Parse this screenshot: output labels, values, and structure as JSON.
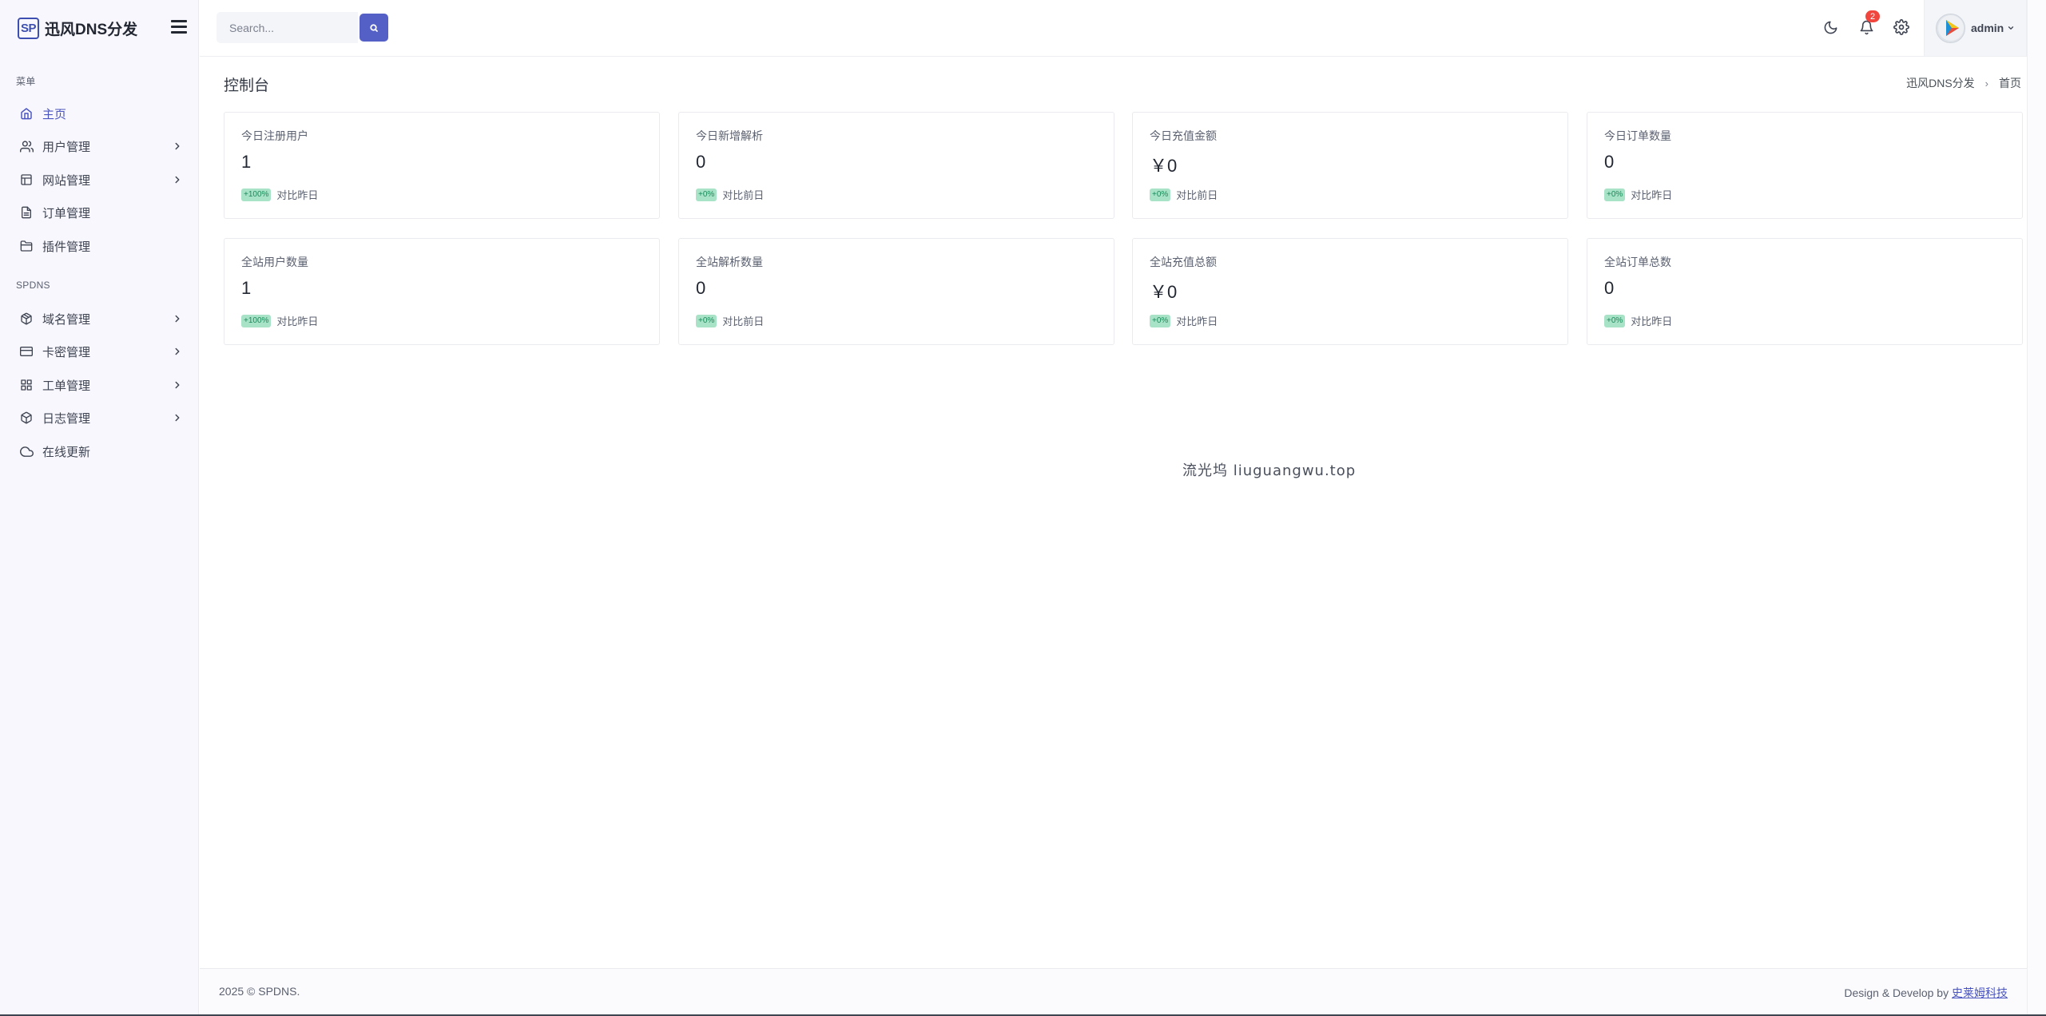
{
  "brand": {
    "logo_text": "SP",
    "name": "迅风DNS分发"
  },
  "sidebar": {
    "sections": [
      {
        "title": "菜单"
      },
      {
        "title": "SPDNS"
      }
    ],
    "items": [
      {
        "label": "主页",
        "icon": "home-icon",
        "active": true,
        "has_children": false
      },
      {
        "label": "用户管理",
        "icon": "users-icon",
        "active": false,
        "has_children": true
      },
      {
        "label": "网站管理",
        "icon": "layout-icon",
        "active": false,
        "has_children": true
      },
      {
        "label": "订单管理",
        "icon": "file-text-icon",
        "active": false,
        "has_children": false
      },
      {
        "label": "插件管理",
        "icon": "folder-icon",
        "active": false,
        "has_children": false
      },
      {
        "label": "域名管理",
        "icon": "package-icon",
        "active": false,
        "has_children": true
      },
      {
        "label": "卡密管理",
        "icon": "credit-card-icon",
        "active": false,
        "has_children": true
      },
      {
        "label": "工单管理",
        "icon": "grid-icon",
        "active": false,
        "has_children": true
      },
      {
        "label": "日志管理",
        "icon": "box-icon",
        "active": false,
        "has_children": true
      },
      {
        "label": "在线更新",
        "icon": "cloud-icon",
        "active": false,
        "has_children": false
      }
    ]
  },
  "topbar": {
    "search_placeholder": "Search...",
    "notification_count": "2",
    "user_name": "admin"
  },
  "page": {
    "title": "控制台",
    "breadcrumb": [
      "迅风DNS分发",
      "首页"
    ]
  },
  "cards": [
    {
      "title": "今日注册用户",
      "value": "1",
      "pct": "+100%",
      "compare": "对比昨日"
    },
    {
      "title": "今日新增解析",
      "value": "0",
      "pct": "+0%",
      "compare": "对比前日"
    },
    {
      "title": "今日充值金额",
      "value": "￥0",
      "pct": "+0%",
      "compare": "对比前日"
    },
    {
      "title": "今日订单数量",
      "value": "0",
      "pct": "+0%",
      "compare": "对比昨日"
    },
    {
      "title": "全站用户数量",
      "value": "1",
      "pct": "+100%",
      "compare": "对比昨日"
    },
    {
      "title": "全站解析数量",
      "value": "0",
      "pct": "+0%",
      "compare": "对比前日"
    },
    {
      "title": "全站充值总额",
      "value": "￥0",
      "pct": "+0%",
      "compare": "对比昨日"
    },
    {
      "title": "全站订单总数",
      "value": "0",
      "pct": "+0%",
      "compare": "对比昨日"
    }
  ],
  "watermark": "流光坞 liuguangwu.top",
  "footer": {
    "left": "2025 © SPDNS.",
    "right_prefix": "Design & Develop by ",
    "right_link": "史莱姆科技"
  },
  "colors": {
    "accent": "#5560c6",
    "sidebar_bg": "#f8f7fd",
    "badge": "#f0463e",
    "pct_badge_bg": "#a8e2c7"
  }
}
